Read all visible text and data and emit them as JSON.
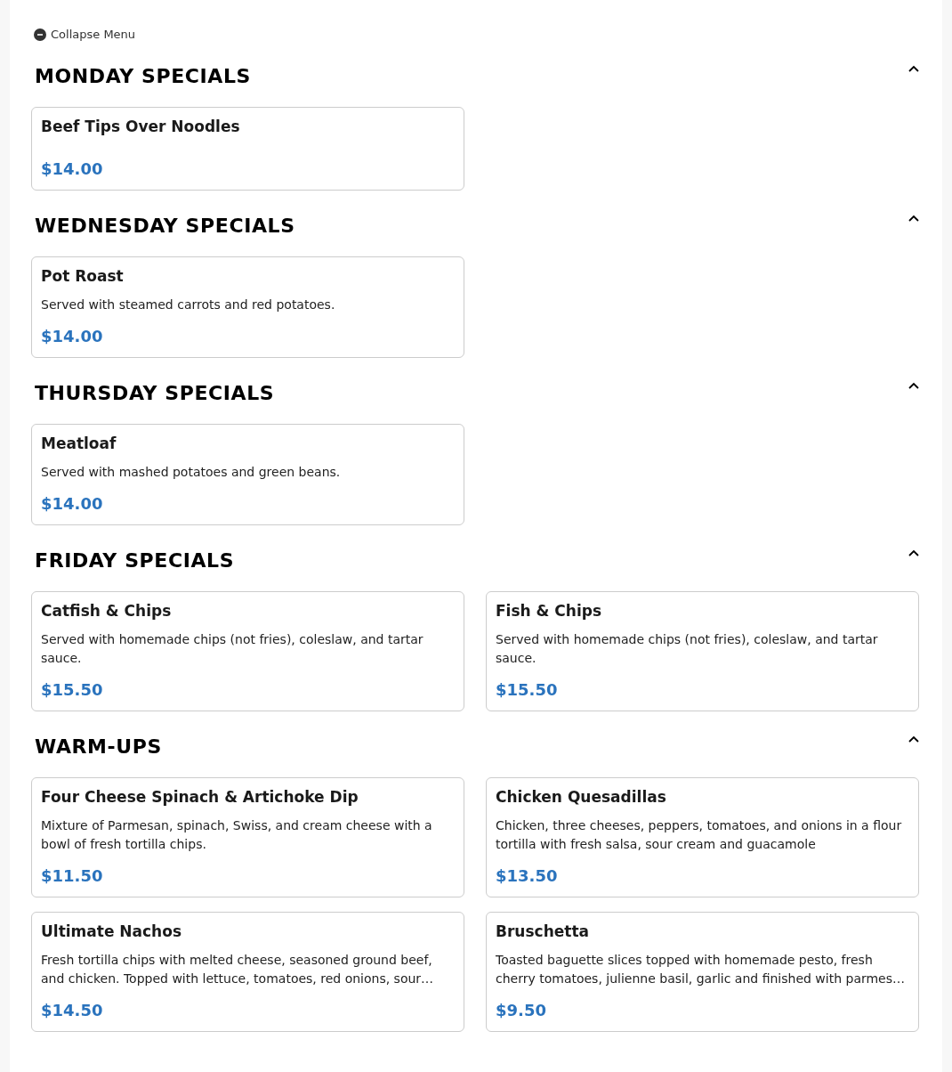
{
  "collapse_button": {
    "label": "Collapse Menu"
  },
  "sections": [
    {
      "title": "MONDAY SPECIALS",
      "expanded": true,
      "items": [
        {
          "name": "Beef Tips Over Noodles",
          "price": "$14.00"
        }
      ]
    },
    {
      "title": "WEDNESDAY SPECIALS",
      "expanded": true,
      "items": [
        {
          "name": "Pot Roast",
          "description": "Served with steamed carrots and red potatoes.",
          "price": "$14.00"
        }
      ]
    },
    {
      "title": "THURSDAY SPECIALS",
      "expanded": true,
      "items": [
        {
          "name": "Meatloaf",
          "description": "Served with mashed potatoes and green beans.",
          "price": "$14.00"
        }
      ]
    },
    {
      "title": "FRIDAY SPECIALS",
      "expanded": true,
      "items": [
        {
          "name": "Catfish & Chips",
          "description": "Served with homemade chips (not fries), coleslaw, and tartar sauce.",
          "price": "$15.50"
        },
        {
          "name": "Fish & Chips",
          "description": "Served with homemade chips (not fries), coleslaw, and tartar sauce.",
          "price": "$15.50"
        }
      ]
    },
    {
      "title": "WARM-UPS",
      "expanded": true,
      "items": [
        {
          "name": "Four Cheese Spinach & Artichoke Dip",
          "description": "Mixture of Parmesan, spinach, Swiss, and cream cheese with a bowl of fresh tortilla chips.",
          "price": "$11.50"
        },
        {
          "name": "Chicken Quesadillas",
          "description": "Chicken, three cheeses, peppers, tomatoes, and onions in a flour tortilla with fresh salsa, sour cream and guacamole",
          "price": "$13.50"
        },
        {
          "name": "Ultimate Nachos",
          "description": "Fresh tortilla chips with melted cheese, seasoned ground beef, and chicken. Topped with lettuce, tomatoes, red onions, sour…",
          "price": "$14.50"
        },
        {
          "name": "Bruschetta",
          "description": "Toasted baguette slices topped with homemade pesto, fresh cherry tomatoes, julienne basil, garlic and finished with parmes…",
          "price": "$9.50"
        }
      ]
    }
  ]
}
